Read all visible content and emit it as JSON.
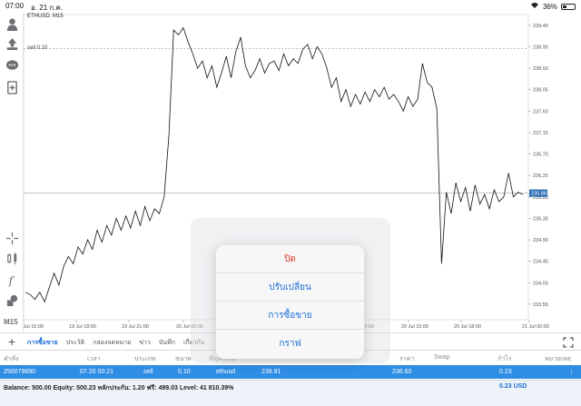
{
  "status_bar": {
    "time": "07:00",
    "date": "อ. 21 ก.ค.",
    "battery": "36%"
  },
  "chart": {
    "symbol": "ETHUSD, M15",
    "sell_label": "sell 0.10",
    "current_price_label": "235.88",
    "timeframe": "M15"
  },
  "chart_data": {
    "type": "line",
    "x_labels": [
      "19 Jul 15:00",
      "19 Jul 18:00",
      "19 Jul 21:00",
      "20 Jul 00:00",
      "20 Jul 12:00",
      "20 Jul 15:00",
      "20 Jul 18:00",
      "21 Jul 00:00"
    ],
    "y_ticks": [
      239.4,
      238.95,
      238.5,
      238.05,
      237.6,
      237.15,
      236.7,
      236.25,
      235.8,
      235.35,
      234.9,
      234.45,
      234.0,
      233.55
    ],
    "ylim": [
      233.3,
      239.55
    ],
    "sell_level": 238.91,
    "current_level": 235.88,
    "values": [
      233.8,
      233.75,
      233.65,
      233.8,
      233.6,
      233.9,
      234.2,
      233.95,
      234.35,
      234.55,
      234.4,
      234.75,
      234.6,
      234.9,
      234.7,
      235.1,
      234.85,
      235.2,
      235.0,
      235.35,
      235.1,
      235.4,
      235.15,
      235.5,
      235.2,
      235.6,
      235.3,
      235.55,
      235.45,
      235.8,
      237.1,
      239.3,
      239.2,
      239.35,
      239.05,
      238.8,
      238.5,
      238.65,
      238.3,
      238.55,
      238.1,
      238.4,
      238.75,
      238.3,
      238.85,
      239.15,
      238.55,
      238.3,
      238.45,
      238.7,
      238.4,
      238.6,
      238.65,
      238.45,
      238.8,
      238.55,
      238.7,
      238.6,
      238.9,
      239.0,
      238.7,
      238.95,
      238.8,
      238.5,
      238.1,
      238.3,
      237.8,
      238.05,
      237.7,
      237.95,
      237.75,
      238.0,
      237.8,
      238.05,
      237.9,
      238.1,
      237.85,
      237.95,
      237.8,
      237.6,
      237.9,
      237.7,
      237.85,
      238.6,
      238.2,
      238.1,
      237.65,
      234.4,
      235.9,
      235.45,
      236.1,
      235.7,
      236.0,
      235.5,
      236.05,
      235.65,
      235.85,
      235.55,
      235.95,
      235.7,
      235.8,
      236.3,
      235.8,
      235.9,
      235.85
    ]
  },
  "left_toolbar": {
    "icons": [
      "person-icon",
      "trade-icon",
      "chat-icon",
      "add-document-icon",
      "crosshair-icon",
      "indicator-icon",
      "function-icon",
      "objects-icon"
    ]
  },
  "tabs": [
    {
      "label": "การซื้อขาย",
      "active": true
    },
    {
      "label": "ประวัติ",
      "active": false
    },
    {
      "label": "กล่องจดหมาย",
      "active": false
    },
    {
      "label": "ข่าว",
      "active": false
    },
    {
      "label": "บันทึก",
      "active": false
    },
    {
      "label": "เกี่ยวกับ",
      "active": false
    }
  ],
  "table": {
    "headers": {
      "order": "คำสั่ง",
      "time": "เวลา",
      "type": "ประเภท",
      "size": "ขนาด",
      "symbol": "สัญลักษณ์",
      "price": "ราคา",
      "swap": "Swap",
      "profit": "กำไร",
      "comment": "หมายเหตุ"
    },
    "row": {
      "order": "250079890",
      "time": "07.20 00:21",
      "type": "sell",
      "size": "0.10",
      "symbol": "ethusd",
      "open_price": "238.91",
      "current_price": "236.60",
      "profit": "0.23"
    }
  },
  "balance": {
    "text": "Balance: 500.00 Equity: 500.23 หลักประกัน: 1.20 ฟรี: 499.03 Level: 41 810.39%",
    "total": "0.23  USD"
  },
  "popup": {
    "close_label": "ปิด",
    "modify_label": "ปรับเปลี่ยน",
    "trade_label": "การซื้อขาย",
    "chart_label": "กราฟ"
  },
  "colors": {
    "accent": "#1b6fd6",
    "danger": "#e0392b",
    "selected_row": "#2f8de4"
  }
}
